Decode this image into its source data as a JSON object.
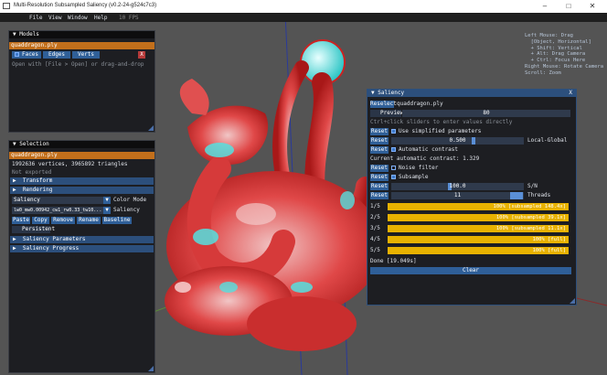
{
  "window": {
    "title": "Multi-Resolution Subsampled Saliency (v0.2-24-g524c7c3)"
  },
  "menu": {
    "items": [
      "File",
      "View",
      "Window",
      "Help"
    ],
    "fps": "10 FPS"
  },
  "hint": {
    "text": "Left Mouse: Drag\n  [Object, Horizontal]\n  + Shift: Vertical\n  + Alt: Drag Camera\n  + Ctrl: Focus Here\nRight Mouse: Rotate Camera\nScroll: Zoom"
  },
  "models": {
    "title": "Models",
    "file": "quaddragon.ply",
    "tabs": [
      "Faces",
      "Edges",
      "Verts"
    ],
    "close": "X",
    "hint": "Open with [File > Open] or drag-and-drop"
  },
  "selection": {
    "title": "Selection",
    "file": "quaddragon.ply",
    "stats": "1992636 vertices, 3965892 triangles",
    "exported": "Not exported",
    "transform": "Transform",
    "rendering": "Rendering",
    "mode_value": "Saliency",
    "mode_label": "Color Mode",
    "layer_value": "lw0_mw0.00942_cw1_rw0.33_tw10...",
    "layer_label": "Saliency",
    "buttons": [
      "Paste",
      "Copy",
      "Remove",
      "Rename",
      "Baseline"
    ],
    "persistent": "Persistent",
    "params": "Saliency Parameters",
    "progress": "Saliency Progress"
  },
  "saliency": {
    "title": "Saliency",
    "close": "X",
    "reselect": "Reselect",
    "file": "quaddragon.ply",
    "preview_label": "Preview",
    "preview_value": "80",
    "ctrl_hint": "Ctrl+click sliders to enter values directly",
    "reset": "Reset",
    "simplified": "Use simplified parameters",
    "local_value": "0.500",
    "local_label": "Local-Global",
    "auto_contrast": "Automatic contrast",
    "current_contrast": "Current automatic contrast: 1.329",
    "noise": "Noise filter",
    "subsample": "Subsample",
    "sn_value": "100.0",
    "sn_label": "S/N",
    "threads_value": "11",
    "threads_label": "Threads",
    "progress": [
      {
        "label": "1/5",
        "text": "100% [subsampled 148.4x]",
        "fraction": 1.0
      },
      {
        "label": "2/5",
        "text": "100% [subsampled 39.1x]",
        "fraction": 1.0
      },
      {
        "label": "3/5",
        "text": "100% [subsampled 11.1x]",
        "fraction": 1.0
      },
      {
        "label": "4/5",
        "text": "100% [full]",
        "fraction": 1.0
      },
      {
        "label": "5/5",
        "text": "100% [full]",
        "fraction": 1.0
      }
    ],
    "done": "Done [19.049s]",
    "clear": "Clear"
  },
  "colors": {
    "accent": "#c26f1b",
    "header": "#2c4f7c",
    "progress": "#e8b200"
  }
}
